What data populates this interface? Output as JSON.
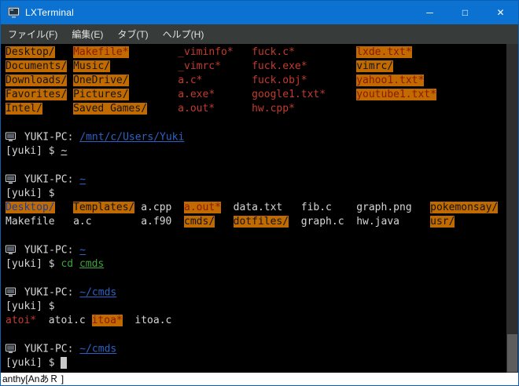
{
  "window": {
    "title": "LXTerminal",
    "controls": {
      "minimize": "─",
      "maximize": "□",
      "close": "✕"
    }
  },
  "menu": {
    "items": [
      "ファイル(F)",
      "編集(E)",
      "タブ(T)",
      "ヘルプ(H)"
    ]
  },
  "ime_status": "anthy[AnあＲ ]",
  "prompt": {
    "host": "YUKI-PC:",
    "user": "[yuki] $"
  },
  "colors": {
    "titlebar_blue": "#0b72d2",
    "dir_highlight_orange": "#c06a00",
    "executable_red": "#c23b2e",
    "path_blue": "#2d62c4",
    "command_green": "#3fa33c",
    "terminal_bg": "#000000",
    "terminal_fg": "#d6d6d6"
  },
  "terminal": {
    "lines": [
      {
        "segs": [
          {
            "t": "Desktop/",
            "s": "d"
          },
          {
            "t": "   "
          },
          {
            "t": "Makefile*",
            "s": "xh"
          },
          {
            "t": "        "
          },
          {
            "t": "_viminfo*",
            "s": "x"
          },
          {
            "t": "   "
          },
          {
            "t": "fuck.c*",
            "s": "x"
          },
          {
            "t": "          "
          },
          {
            "t": "lxde.txt*",
            "s": "xh"
          }
        ]
      },
      {
        "segs": [
          {
            "t": "Documents/",
            "s": "d"
          },
          {
            "t": " "
          },
          {
            "t": "Music/",
            "s": "d"
          },
          {
            "t": "           "
          },
          {
            "t": "_vimrc*",
            "s": "x"
          },
          {
            "t": "     "
          },
          {
            "t": "fuck.exe*",
            "s": "x"
          },
          {
            "t": "        "
          },
          {
            "t": "vimrc/",
            "s": "d"
          }
        ]
      },
      {
        "segs": [
          {
            "t": "Downloads/",
            "s": "d"
          },
          {
            "t": " "
          },
          {
            "t": "OneDrive/",
            "s": "d"
          },
          {
            "t": "        "
          },
          {
            "t": "a.c*",
            "s": "x"
          },
          {
            "t": "        "
          },
          {
            "t": "fuck.obj*",
            "s": "x"
          },
          {
            "t": "        "
          },
          {
            "t": "yahoo1.txt*",
            "s": "xh"
          }
        ]
      },
      {
        "segs": [
          {
            "t": "Favorites/",
            "s": "d"
          },
          {
            "t": " "
          },
          {
            "t": "Pictures/",
            "s": "d"
          },
          {
            "t": "        "
          },
          {
            "t": "a.exe*",
            "s": "x"
          },
          {
            "t": "      "
          },
          {
            "t": "google1.txt*",
            "s": "x"
          },
          {
            "t": "     "
          },
          {
            "t": "youtube1.txt*",
            "s": "xh"
          }
        ]
      },
      {
        "segs": [
          {
            "t": "Intel/",
            "s": "d"
          },
          {
            "t": "     "
          },
          {
            "t": "Saved Games/",
            "s": "d"
          },
          {
            "t": "     "
          },
          {
            "t": "a.out*",
            "s": "x"
          },
          {
            "t": "      "
          },
          {
            "t": "hw.cpp*",
            "s": "x"
          }
        ]
      },
      {
        "segs": []
      },
      {
        "segs": [
          {
            "s": "ico"
          },
          {
            "t": " YUKI-PC: "
          },
          {
            "t": "/mnt/c/Users/Yuki",
            "s": "p"
          }
        ]
      },
      {
        "segs": [
          {
            "t": "[yuki] $ "
          },
          {
            "t": "~",
            "s": "u"
          }
        ]
      },
      {
        "segs": []
      },
      {
        "segs": [
          {
            "s": "ico"
          },
          {
            "t": " YUKI-PC: "
          },
          {
            "t": "~",
            "s": "p"
          }
        ]
      },
      {
        "segs": [
          {
            "t": "[yuki] $"
          }
        ]
      },
      {
        "segs": [
          {
            "t": "Desktop/",
            "s": "db"
          },
          {
            "t": "   "
          },
          {
            "t": "Templates/",
            "s": "d"
          },
          {
            "t": " "
          },
          {
            "t": "a.cpp"
          },
          {
            "t": "  "
          },
          {
            "t": "a.out*",
            "s": "xh"
          },
          {
            "t": "  "
          },
          {
            "t": "data.txt"
          },
          {
            "t": "   "
          },
          {
            "t": "fib.c"
          },
          {
            "t": "    "
          },
          {
            "t": "graph.png"
          },
          {
            "t": "   "
          },
          {
            "t": "pokemonsay/",
            "s": "d"
          }
        ]
      },
      {
        "segs": [
          {
            "t": "Makefile"
          },
          {
            "t": "   "
          },
          {
            "t": "a.c"
          },
          {
            "t": "        "
          },
          {
            "t": "a.f90"
          },
          {
            "t": "  "
          },
          {
            "t": "cmds/",
            "s": "d"
          },
          {
            "t": "   "
          },
          {
            "t": "dotfiles/",
            "s": "d"
          },
          {
            "t": "  "
          },
          {
            "t": "graph.c"
          },
          {
            "t": "  "
          },
          {
            "t": "hw.java"
          },
          {
            "t": "     "
          },
          {
            "t": "usr/",
            "s": "d"
          }
        ]
      },
      {
        "segs": []
      },
      {
        "segs": [
          {
            "s": "ico"
          },
          {
            "t": " YUKI-PC: "
          },
          {
            "t": "~",
            "s": "p"
          }
        ]
      },
      {
        "segs": [
          {
            "t": "[yuki] $ "
          },
          {
            "t": "cd ",
            "s": "g"
          },
          {
            "t": "cmds",
            "s": "gu"
          }
        ]
      },
      {
        "segs": []
      },
      {
        "segs": [
          {
            "s": "ico"
          },
          {
            "t": " YUKI-PC: "
          },
          {
            "t": "~/cmds",
            "s": "p"
          }
        ]
      },
      {
        "segs": [
          {
            "t": "[yuki] $"
          }
        ]
      },
      {
        "segs": [
          {
            "t": "atoi*",
            "s": "x"
          },
          {
            "t": "  "
          },
          {
            "t": "atoi.c"
          },
          {
            "t": " "
          },
          {
            "t": "itoa*",
            "s": "xh"
          },
          {
            "t": "  "
          },
          {
            "t": "itoa.c"
          }
        ]
      },
      {
        "segs": []
      },
      {
        "segs": [
          {
            "s": "ico"
          },
          {
            "t": " YUKI-PC: "
          },
          {
            "t": "~/cmds",
            "s": "p"
          }
        ]
      },
      {
        "segs": [
          {
            "t": "[yuki] $ "
          },
          {
            "s": "cur"
          }
        ]
      }
    ]
  }
}
